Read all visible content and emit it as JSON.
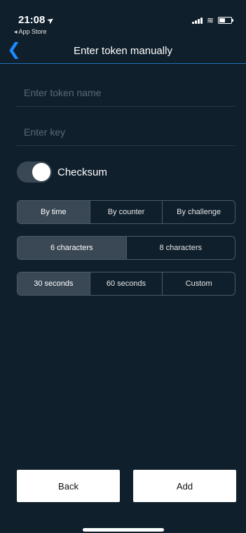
{
  "status_bar": {
    "time": "21:08",
    "back_app": "◂ App Store"
  },
  "nav": {
    "title": "Enter token manually"
  },
  "fields": {
    "token_name_placeholder": "Enter token name",
    "key_placeholder": "Enter key"
  },
  "checksum": {
    "label": "Checksum",
    "enabled": true
  },
  "mode_segment": {
    "options": [
      "By time",
      "By counter",
      "By challenge"
    ],
    "selected": "By time"
  },
  "length_segment": {
    "options": [
      "6 characters",
      "8 characters"
    ],
    "selected": "6 characters"
  },
  "period_segment": {
    "options": [
      "30 seconds",
      "60 seconds",
      "Custom"
    ],
    "selected": "30 seconds"
  },
  "buttons": {
    "back": "Back",
    "add": "Add"
  },
  "colors": {
    "background": "#0f1f2c",
    "accent": "#1c8bff",
    "segment_active": "#3a4855"
  }
}
